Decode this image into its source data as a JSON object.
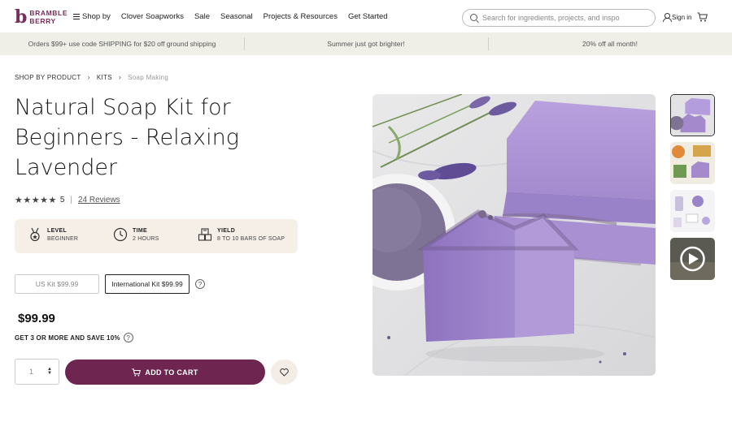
{
  "brand": {
    "line1": "BRAMBLE",
    "line2": "BERRY",
    "mark": "b"
  },
  "nav": {
    "items": [
      {
        "label": "Shop by",
        "icon": "hamburger-icon"
      },
      {
        "label": "Clover Soapworks"
      },
      {
        "label": "Sale"
      },
      {
        "label": "Seasonal"
      },
      {
        "label": "Projects & Resources"
      },
      {
        "label": "Get Started"
      }
    ]
  },
  "search": {
    "placeholder": "Search for ingredients, projects, and inspo"
  },
  "account": {
    "signin": "Sign in"
  },
  "promo": [
    "Orders $99+ use code SHIPPING for $20 off ground shipping",
    "Summer just got brighter!",
    "20% off all month!"
  ],
  "breadcrumb": [
    "SHOP BY PRODUCT",
    "KITS",
    "Soap Making"
  ],
  "product": {
    "title": "Natural Soap Kit for Beginners - Relaxing Lavender",
    "rating_value": "5",
    "stars": "★★★★★",
    "rating_separator": "|",
    "reviews": "24 Reviews",
    "specs": [
      {
        "label": "LEVEL",
        "value": "BEGINNER",
        "icon": "medal-icon"
      },
      {
        "label": "TIME",
        "value": "2 HOURS",
        "icon": "clock-icon"
      },
      {
        "label": "YIELD",
        "value": "8 TO 10 BARS OF SOAP",
        "icon": "soap-bars-icon"
      }
    ],
    "variants": [
      {
        "label": "US Kit $99.99",
        "selected": false
      },
      {
        "label": "International Kit $99.99",
        "selected": true
      }
    ],
    "help_mark": "?",
    "price": "$99.99",
    "bulk_offer": "GET 3 OR MORE AND SAVE 10%",
    "quantity": "1",
    "add_to_cart": "ADD TO CART"
  },
  "colors": {
    "accent": "#6e2650",
    "promo_bg": "#efefe8",
    "spec_bg": "#f6efe8",
    "lavender": "#a68bd0"
  }
}
